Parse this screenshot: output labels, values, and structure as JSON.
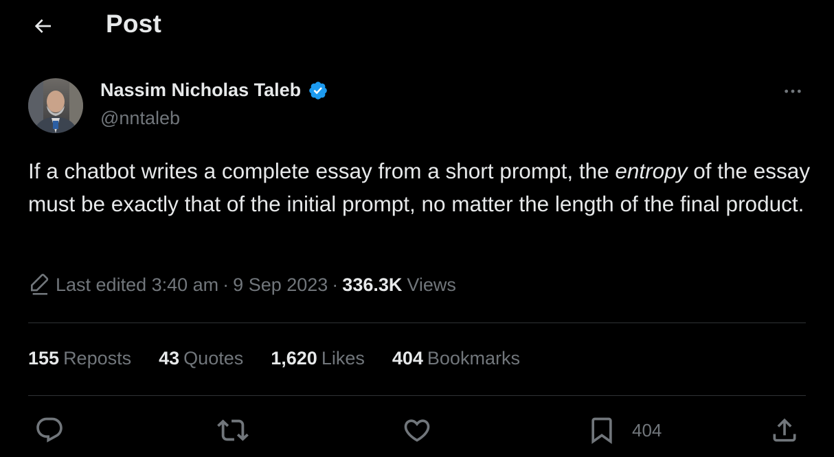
{
  "header": {
    "back_icon": "arrow-left-icon",
    "title": "Post"
  },
  "author": {
    "name": "Nassim Nicholas Taleb",
    "handle": "@nntaleb",
    "verified_icon": "verified-badge-icon",
    "verified_color": "#1d9bf0"
  },
  "post": {
    "text_before": "If a chatbot writes a complete essay from a short prompt, the ",
    "text_italic": "entropy",
    "text_after": " of the essay must be exactly that of the initial prompt, no matter the length of the final product."
  },
  "meta": {
    "edit_icon": "pencil-icon",
    "edited": "Last edited 3:40 am",
    "sep1": "·",
    "date": "9 Sep 2023",
    "sep2": "·",
    "views_count": "336.3K",
    "views_label": "Views"
  },
  "stats": [
    {
      "value": "155",
      "label": "Reposts"
    },
    {
      "value": "43",
      "label": "Quotes"
    },
    {
      "value": "1,620",
      "label": "Likes"
    },
    {
      "value": "404",
      "label": "Bookmarks"
    }
  ],
  "actions": {
    "reply_icon": "reply-icon",
    "repost_icon": "repost-icon",
    "like_icon": "heart-icon",
    "bookmark_icon": "bookmark-icon",
    "bookmark_count": "404",
    "share_icon": "share-icon"
  },
  "colors": {
    "background": "#000000",
    "primary_text": "#e7e9ea",
    "secondary_text": "#71767b",
    "divider": "#2f3336"
  }
}
